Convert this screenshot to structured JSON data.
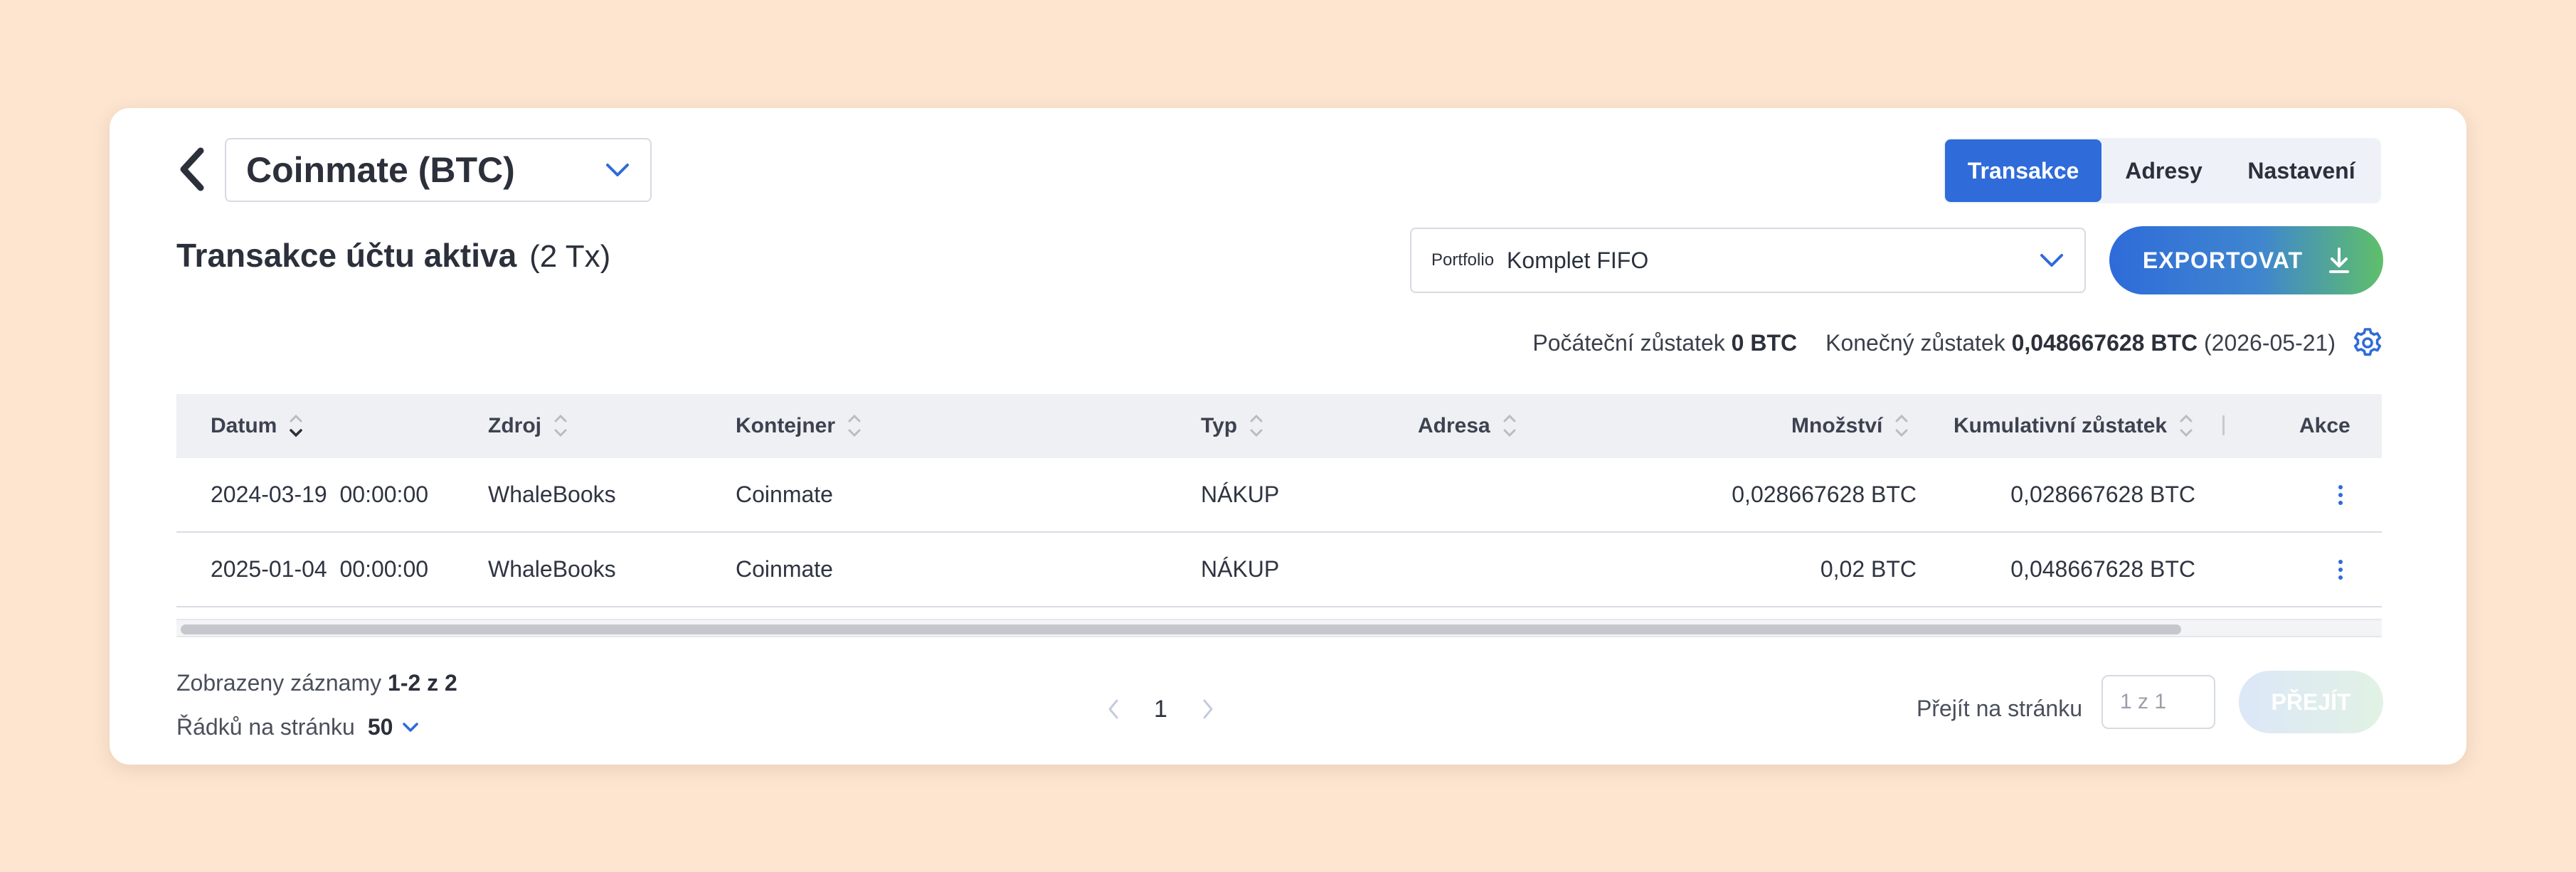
{
  "account_select": {
    "value": "Coinmate (BTC)"
  },
  "tabs": [
    {
      "label": "Transakce",
      "active": true
    },
    {
      "label": "Adresy",
      "active": false
    },
    {
      "label": "Nastavení",
      "active": false
    }
  ],
  "header": {
    "title": "Transakce účtu aktiva",
    "count": "(2 Tx)"
  },
  "portfolio": {
    "label": "Portfolio",
    "value": "Komplet FIFO"
  },
  "export": {
    "label": "EXPORTOVAT"
  },
  "balances": {
    "opening_label": "Počáteční zůstatek",
    "opening_value": "0 BTC",
    "closing_label": "Konečný zůstatek",
    "closing_value": "0,048667628 BTC",
    "closing_date": "(2026-05-21)"
  },
  "table": {
    "columns": [
      {
        "key": "datum",
        "label": "Datum"
      },
      {
        "key": "zdroj",
        "label": "Zdroj"
      },
      {
        "key": "kontejner",
        "label": "Kontejner"
      },
      {
        "key": "typ",
        "label": "Typ"
      },
      {
        "key": "adresa",
        "label": "Adresa"
      },
      {
        "key": "mnozstvi",
        "label": "Množství"
      },
      {
        "key": "kumulativni",
        "label": "Kumulativní zůstatek"
      },
      {
        "key": "akce",
        "label": "Akce"
      }
    ],
    "rows": [
      {
        "datum": "2024-03-19  00:00:00",
        "zdroj": "WhaleBooks",
        "kontejner": "Coinmate",
        "typ": "NÁKUP",
        "adresa": "",
        "mnozstvi": "0,028667628 BTC",
        "kumulativni": "0,028667628 BTC"
      },
      {
        "datum": "2025-01-04  00:00:00",
        "zdroj": "WhaleBooks",
        "kontejner": "Coinmate",
        "typ": "NÁKUP",
        "adresa": "",
        "mnozstvi": "0,02 BTC",
        "kumulativni": "0,048667628 BTC"
      }
    ]
  },
  "footer": {
    "records_label": "Zobrazeny záznamy",
    "records_value": "1-2 z 2",
    "rows_per_page_label": "Řádků na stránku",
    "rows_per_page_value": "50",
    "current_page": "1",
    "goto_label": "Přejít na stránku",
    "goto_placeholder": "1 z 1",
    "goto_button": "PŘEJÍT"
  },
  "colors": {
    "background": "#fde5cf",
    "accent": "#2f6bd9",
    "gradient_end": "#5fbf6a"
  }
}
